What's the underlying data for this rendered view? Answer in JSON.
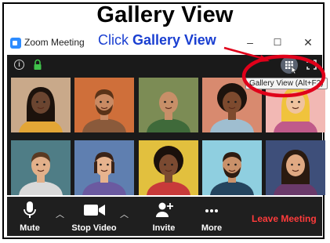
{
  "headline": "Gallery View",
  "annotation": {
    "click": "Click",
    "target": "Gallery View"
  },
  "window": {
    "title": "Zoom Meeting",
    "controls": {
      "minimize": "–",
      "maximize": "☐",
      "close": "✕"
    }
  },
  "tooltip": "Gallery View (Alt+F2)",
  "toolbar": {
    "mute": "Mute",
    "stop_video": "Stop Video",
    "invite": "Invite",
    "more": "More",
    "leave": "Leave Meeting"
  },
  "colors": {
    "annotation_red": "#e0001a",
    "annotation_blue": "#1a3fd1",
    "leave_red": "#ff3b3b",
    "app_blue": "#2d8cff"
  },
  "participants": [
    {
      "bg": "#c9a98a",
      "skin": "#6b4530",
      "hair": "#1c120c",
      "shirt": "#e3a636",
      "style": "long"
    },
    {
      "bg": "#cf6f3a",
      "skin": "#c98a63",
      "hair": "#5a3318",
      "shirt": "#8a5a3b",
      "style": "beard"
    },
    {
      "bg": "#7c8c55",
      "skin": "#c78f68",
      "hair": "#c78f68",
      "shirt": "#3f6a3a",
      "style": "bald"
    },
    {
      "bg": "#d88a6f",
      "skin": "#7d4a2e",
      "hair": "#1d130d",
      "shirt": "#9fbed0",
      "style": "afro"
    },
    {
      "bg": "#f2b8b4",
      "skin": "#f0c39e",
      "hair": "#f0c33c",
      "shirt": "#c05a8a",
      "style": "blonde"
    },
    {
      "bg": "#4f7d86",
      "skin": "#e2b08a",
      "hair": "#5a3a22",
      "shirt": "#d9d9d9",
      "style": "short"
    },
    {
      "bg": "#5f7fb0",
      "skin": "#e7b38e",
      "hair": "#3a2318",
      "shirt": "#6b5aa0",
      "style": "bob"
    },
    {
      "bg": "#e2c03e",
      "skin": "#7b4a31",
      "hair": "#1a100b",
      "shirt": "#c83a3a",
      "style": "curly"
    },
    {
      "bg": "#8fcfe0",
      "skin": "#c9916a",
      "hair": "#2e1c12",
      "shirt": "#24445e",
      "style": "beard"
    },
    {
      "bg": "#3e4f7a",
      "skin": "#e0a983",
      "hair": "#2a1a10",
      "shirt": "#6a3a6a",
      "style": "long"
    }
  ]
}
